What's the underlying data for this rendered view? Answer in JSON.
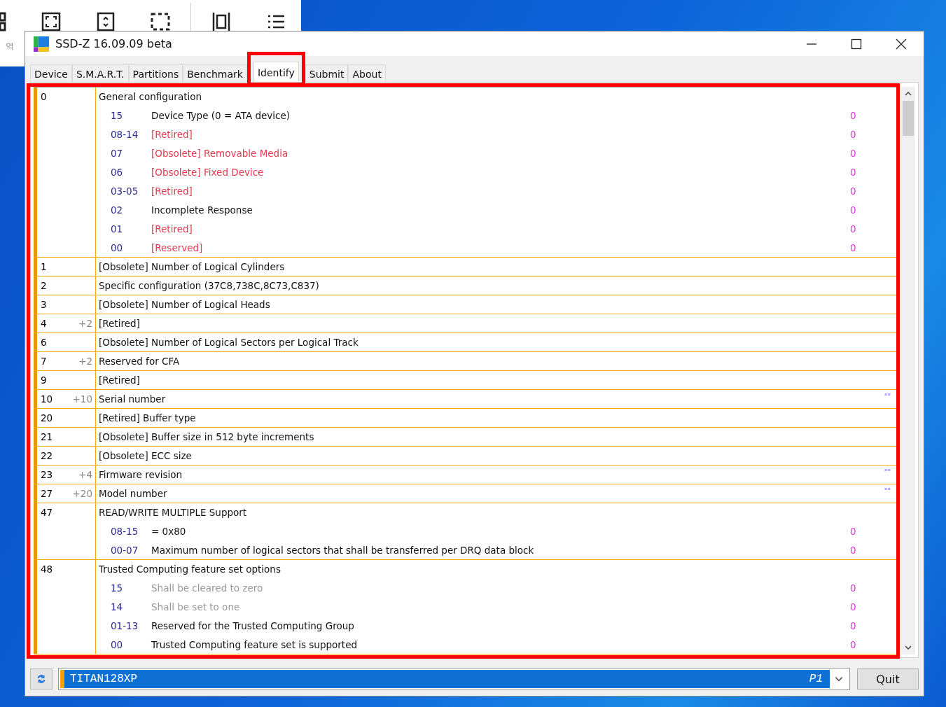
{
  "background_window": {
    "label": "역"
  },
  "window": {
    "title": "SSD-Z 16.09.09 beta"
  },
  "tabs": [
    {
      "label": "Device",
      "selected": false
    },
    {
      "label": "S.M.A.R.T.",
      "selected": false
    },
    {
      "label": "Partitions",
      "selected": false
    },
    {
      "label": "Benchmark",
      "selected": false
    },
    {
      "label": "Identify",
      "selected": true
    },
    {
      "label": "Submit",
      "selected": false
    },
    {
      "label": "About",
      "selected": false
    }
  ],
  "identify_rows": [
    {
      "word": "0",
      "label": "General configuration",
      "bits": [
        {
          "bits": "15",
          "label": "Device Type (0 = ATA device)",
          "kind": "normal",
          "value": "0"
        },
        {
          "bits": "08-14",
          "label": "[Retired]",
          "kind": "retired",
          "value": "0"
        },
        {
          "bits": "07",
          "label": "[Obsolete] Removable Media",
          "kind": "retired",
          "value": "0"
        },
        {
          "bits": "06",
          "label": "[Obsolete] Fixed Device",
          "kind": "retired",
          "value": "0"
        },
        {
          "bits": "03-05",
          "label": "[Retired]",
          "kind": "retired",
          "value": "0"
        },
        {
          "bits": "02",
          "label": "Incomplete Response",
          "kind": "normal",
          "value": "0"
        },
        {
          "bits": "01",
          "label": "[Retired]",
          "kind": "retired",
          "value": "0"
        },
        {
          "bits": "00",
          "label": "[Reserved]",
          "kind": "retired",
          "value": "0"
        }
      ]
    },
    {
      "word": "1",
      "label": "[Obsolete] Number of Logical Cylinders"
    },
    {
      "word": "2",
      "label": "Specific configuration (37C8,738C,8C73,C837)"
    },
    {
      "word": "3",
      "label": "[Obsolete] Number of Logical Heads"
    },
    {
      "word": "4",
      "count": "+2",
      "label": "[Retired]"
    },
    {
      "word": "6",
      "label": "[Obsolete] Number of Logical Sectors per Logical Track"
    },
    {
      "word": "7",
      "count": "+2",
      "label": "Reserved for CFA"
    },
    {
      "word": "9",
      "label": "[Retired]"
    },
    {
      "word": "10",
      "count": "+10",
      "label": "Serial number",
      "value": "\"\""
    },
    {
      "word": "20",
      "label": "[Retired] Buffer type"
    },
    {
      "word": "21",
      "label": "[Obsolete] Buffer size in 512 byte increments"
    },
    {
      "word": "22",
      "label": "[Obsolete] ECC size"
    },
    {
      "word": "23",
      "count": "+4",
      "label": "Firmware revision",
      "value": "\"\""
    },
    {
      "word": "27",
      "count": "+20",
      "label": "Model number",
      "value": "\"\""
    },
    {
      "word": "47",
      "label": "READ/WRITE MULTIPLE Support",
      "bits": [
        {
          "bits": "08-15",
          "label": "= 0x80",
          "kind": "normal",
          "value": "0"
        },
        {
          "bits": "00-07",
          "label": "Maximum number of logical sectors that shall be transferred per DRQ data block",
          "kind": "normal",
          "value": "0"
        }
      ]
    },
    {
      "word": "48",
      "label": "Trusted Computing feature set options",
      "bits": [
        {
          "bits": "15",
          "label": "Shall be cleared to zero",
          "kind": "fixed",
          "value": "0"
        },
        {
          "bits": "14",
          "label": "Shall be set to one",
          "kind": "fixed",
          "value": "0"
        },
        {
          "bits": "01-13",
          "label": "Reserved for the Trusted Computing Group",
          "kind": "normal",
          "value": "0"
        },
        {
          "bits": "00",
          "label": "Trusted Computing feature set is supported",
          "kind": "normal",
          "value": "0"
        }
      ]
    }
  ],
  "drive": {
    "name": "TITAN128XP",
    "partition": "P1"
  },
  "buttons": [
    "Quit"
  ]
}
